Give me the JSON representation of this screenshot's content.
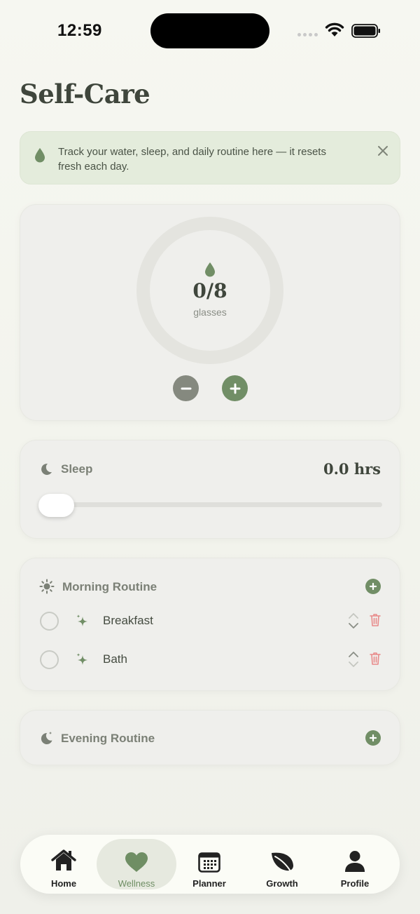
{
  "status_bar": {
    "time": "12:59"
  },
  "page": {
    "title": "Self-Care"
  },
  "tip": {
    "text": "Track your water, sleep, and daily routine here — it resets fresh each day."
  },
  "water": {
    "count": "0/8",
    "unit": "glasses",
    "progress": 0
  },
  "sleep": {
    "label": "Sleep",
    "hours": "0.0 hrs",
    "slider_value": 0
  },
  "morning": {
    "title": "Morning Routine",
    "items": [
      {
        "name": "Breakfast",
        "done": false
      },
      {
        "name": "Bath",
        "done": false
      }
    ]
  },
  "evening": {
    "title": "Evening Routine"
  },
  "tabs": [
    {
      "label": "Home",
      "icon": "house-icon"
    },
    {
      "label": "Wellness",
      "icon": "heart-icon",
      "active": true
    },
    {
      "label": "Planner",
      "icon": "calendar-icon"
    },
    {
      "label": "Growth",
      "icon": "leaf-icon"
    },
    {
      "label": "Profile",
      "icon": "person-icon"
    }
  ],
  "colors": {
    "accent": "#718e66",
    "danger": "#e88a8a",
    "text": "#3f463c"
  }
}
